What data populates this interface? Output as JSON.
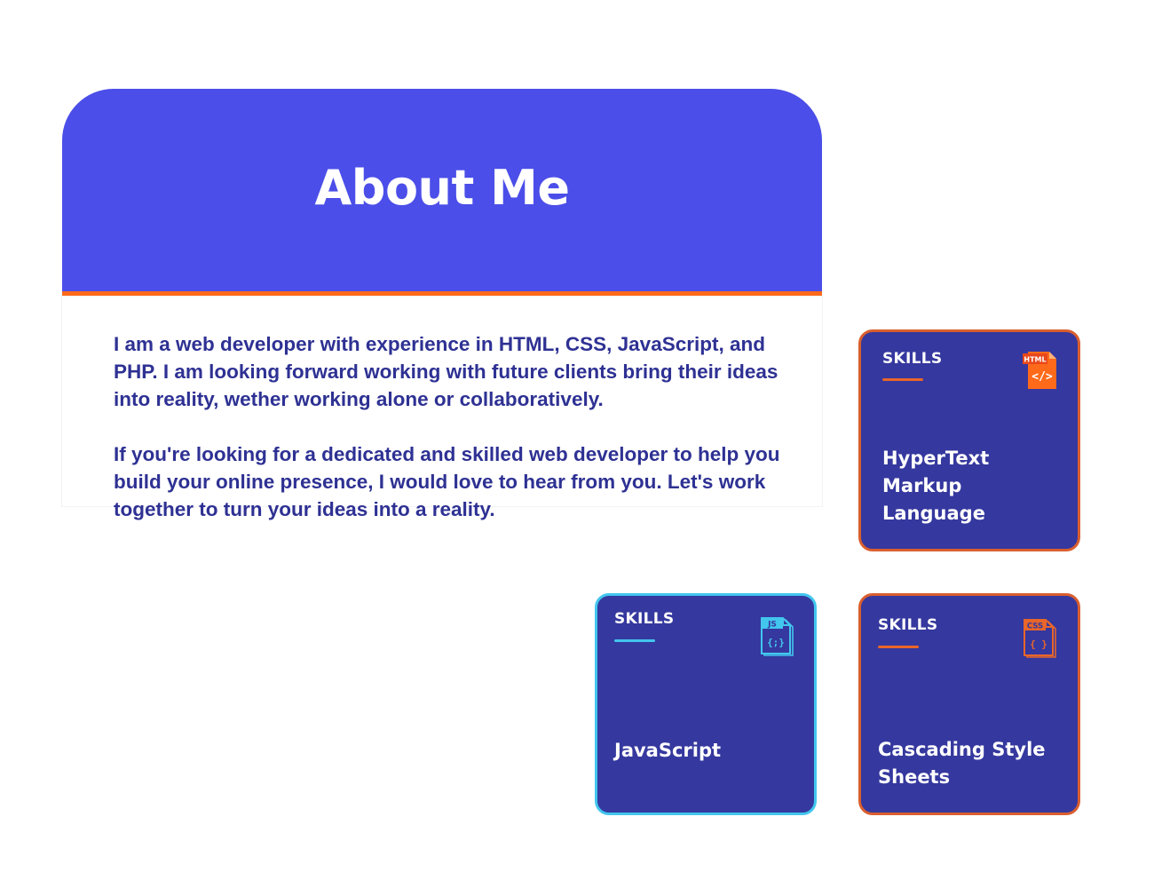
{
  "about": {
    "title": "About Me",
    "paragraphs": [
      "I am a web developer with experience in HTML, CSS, JavaScript, and PHP. I am looking forward working with future clients bring their ideas into reality, wether working alone or collaboratively.",
      "If you're looking for a dedicated and skilled web developer to help you build your online presence, I would love to hear from you. Let's work together to turn your ideas into a reality."
    ]
  },
  "skills": [
    {
      "label": "SKILLS",
      "name": "HyperText Markup Language",
      "icon": "html-file-icon",
      "icon_text": "HTML",
      "accent": "#e8662a"
    },
    {
      "label": "SKILLS",
      "name": "JavaScript",
      "icon": "js-file-icon",
      "icon_text": "JS",
      "accent": "#42c6ee"
    },
    {
      "label": "SKILLS",
      "name": "Cascading Style Sheets",
      "icon": "css-file-icon",
      "icon_text": "CSS",
      "accent": "#e8662a"
    }
  ],
  "colors": {
    "header_bg": "#4b4ee8",
    "header_accent": "#ff6a1a",
    "text": "#2e3193",
    "card_bg": "#35389e",
    "card_border": "#d95f2f",
    "card_border_js": "#42c6ee"
  }
}
